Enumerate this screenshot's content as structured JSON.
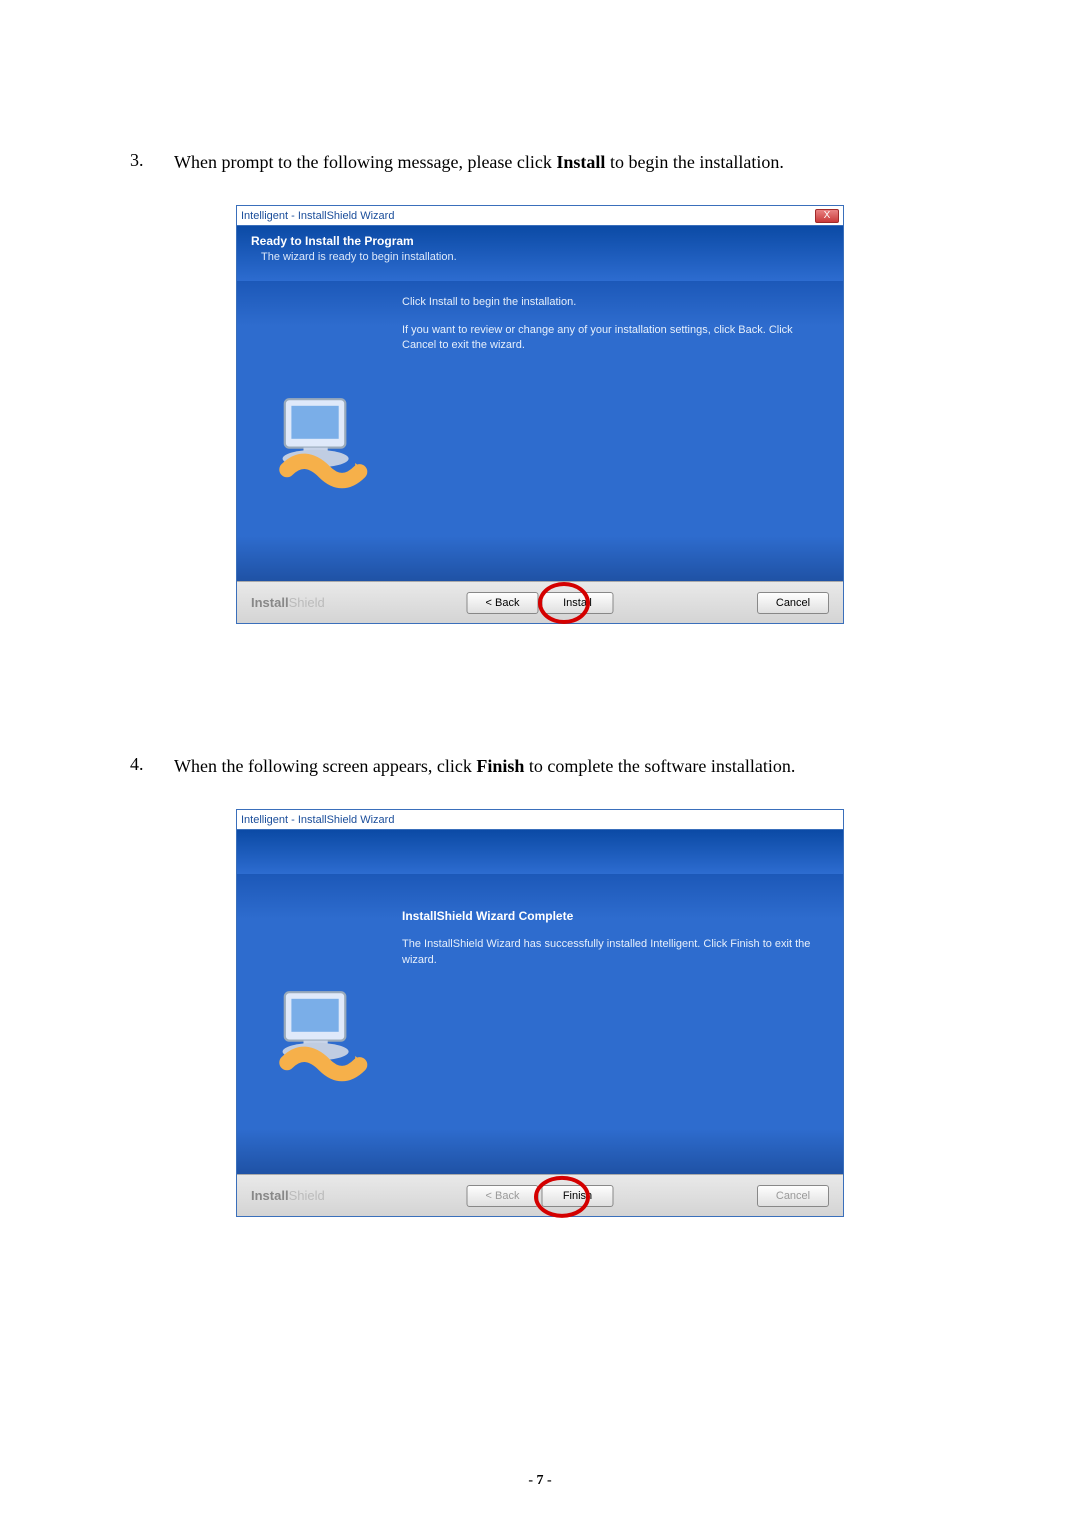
{
  "steps": {
    "step3": {
      "number": "3.",
      "text_before": "When prompt to the following message, please click ",
      "bold": "Install",
      "text_after": " to begin the installation."
    },
    "step4": {
      "number": "4.",
      "text_before": "When the following screen appears, click ",
      "bold": "Finish",
      "text_after": " to complete the software installation."
    }
  },
  "dialog1": {
    "title": "Intelligent - InstallShield Wizard",
    "close_label": "X",
    "header_title": "Ready to Install the Program",
    "header_sub": "The wizard is ready to begin installation.",
    "body_line1": "Click Install to begin the installation.",
    "body_line2": "If you want to review or change any of your installation settings, click Back. Click Cancel to exit the wizard.",
    "brand_a": "Install",
    "brand_b": "Shield",
    "btn_back": "< Back",
    "btn_install": "Install",
    "btn_cancel": "Cancel"
  },
  "dialog2": {
    "title": "Intelligent - InstallShield Wizard",
    "body_title": "InstallShield Wizard Complete",
    "body_line1": "The InstallShield Wizard has successfully installed Intelligent.  Click Finish to exit the wizard.",
    "brand_a": "Install",
    "brand_b": "Shield",
    "btn_back": "< Back",
    "btn_finish": "Finish",
    "btn_cancel": "Cancel"
  },
  "page_number": "- 7 -"
}
